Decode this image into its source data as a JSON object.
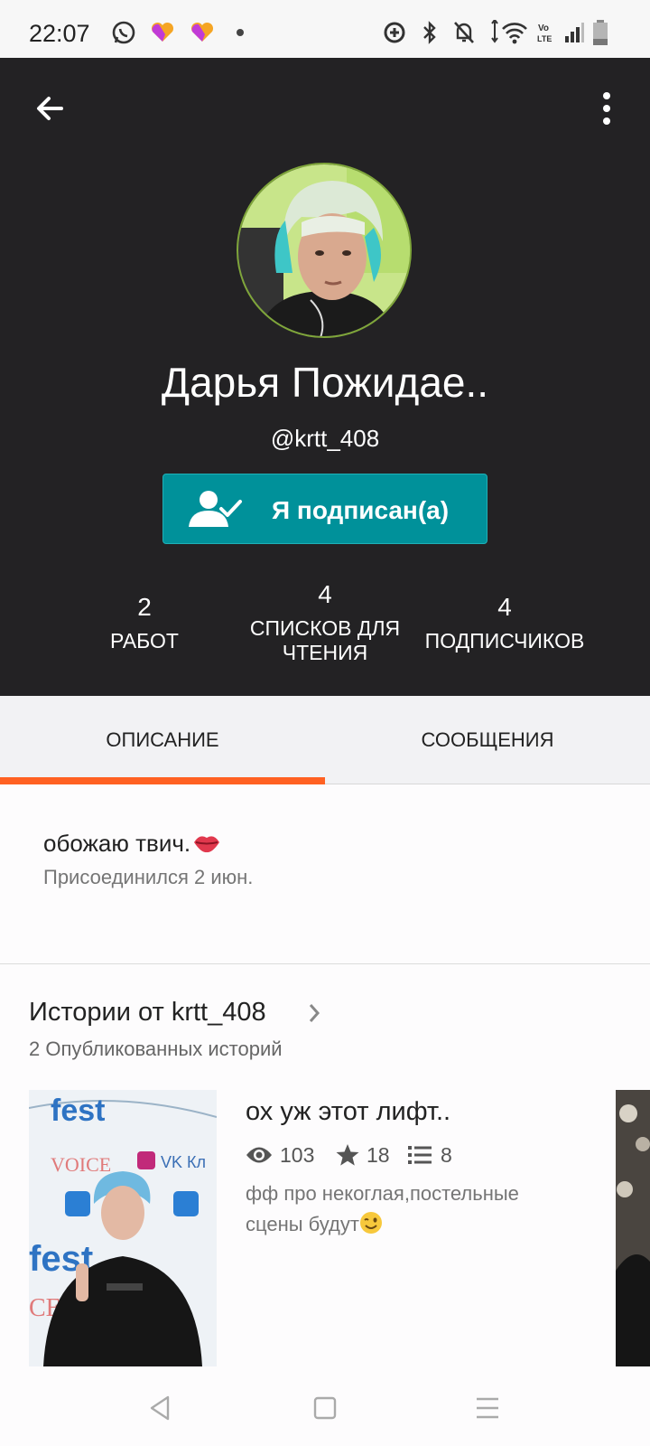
{
  "status_bar": {
    "time": "22:07",
    "left_icons": [
      "whatsapp-icon",
      "likee-icon",
      "likee-icon",
      "dot-icon"
    ],
    "right_icons": [
      "sync-icon",
      "bluetooth-icon",
      "mute-icon",
      "wifi-icon",
      "volte-icon",
      "signal-icon",
      "battery-icon"
    ],
    "volte_text": "Vo LTE"
  },
  "header": {
    "name": "Дарья Пожидае..",
    "handle": "@krtt_408",
    "follow_button": "Я подписан(а)",
    "stats": [
      {
        "value": "2",
        "label": "РАБОТ"
      },
      {
        "value": "4",
        "label": "СПИСКОВ ДЛЯ ЧТЕНИЯ"
      },
      {
        "value": "4",
        "label": "ПОДПИСЧИКОВ"
      }
    ]
  },
  "tabs": {
    "items": [
      "ОПИСАНИЕ",
      "СООБЩЕНИЯ"
    ],
    "active": "ОПИСАНИЕ"
  },
  "about": {
    "text": "обожаю твич.",
    "emoji": "kiss-lips-icon",
    "joined": "Присоединился 2 июн."
  },
  "stories": {
    "title": "Истории от krtt_408",
    "count": "2 Опубликованных историй",
    "items": [
      {
        "title": "ох уж этот лифт..",
        "views": "103",
        "votes": "18",
        "parts": "8",
        "description": "фф про некоглая,постельные сцены будут",
        "emoji": "winking-face-icon"
      }
    ]
  },
  "colors": {
    "header_bg": "#232224",
    "follow_button": "#00919a",
    "tab_indicator": "#ff6122",
    "page_bg": "#fdfcfd"
  }
}
